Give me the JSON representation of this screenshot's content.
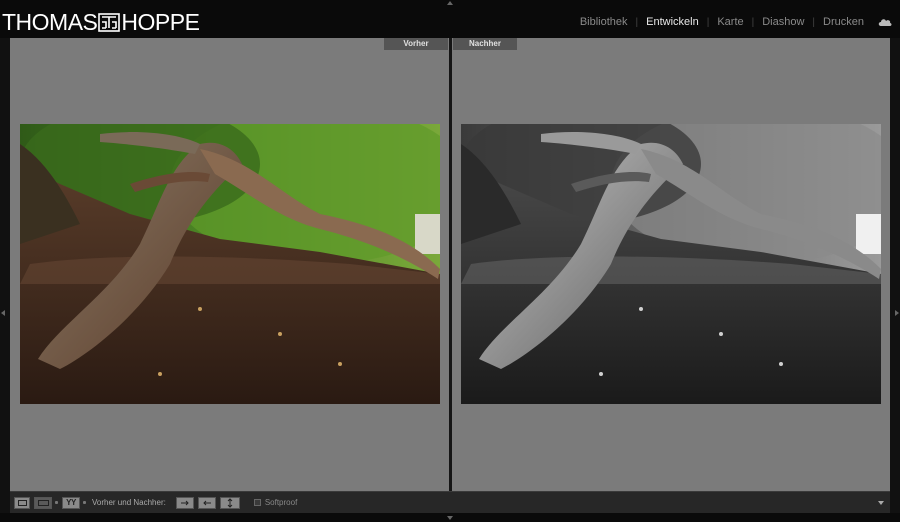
{
  "brand": {
    "logo_left": "THOMAS",
    "logo_right": "HOPPE"
  },
  "modules": [
    {
      "label": "Bibliothek",
      "active": false
    },
    {
      "label": "Entwickeln",
      "active": true
    },
    {
      "label": "Karte",
      "active": false
    },
    {
      "label": "Diashow",
      "active": false
    },
    {
      "label": "Drucken",
      "active": false
    }
  ],
  "identity_icon": "cloud-icon",
  "compare": {
    "before_label": "Vorher",
    "after_label": "Nachher"
  },
  "toolbar": {
    "view_modes": [
      "loupe-view-icon",
      "before-after-icon",
      "yy-icon"
    ],
    "yy_label": "YY",
    "before_after_label": "Vorher und Nachher:",
    "swap_icons": [
      "copy-before-to-after-icon",
      "copy-after-to-before-icon",
      "swap-before-after-icon"
    ],
    "softproof_label": "Softproof",
    "softproof_checked": false
  },
  "colors": {
    "background": "#7b7b7b",
    "topbar": "#0a0a0a",
    "active_module": "#e8e8e8",
    "inactive_module": "#8a8a8a"
  }
}
